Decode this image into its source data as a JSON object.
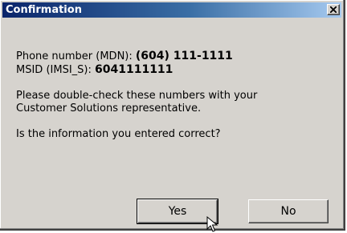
{
  "window": {
    "title": "Confirmation",
    "close_icon": "close-x-icon"
  },
  "message": {
    "phone_label": "Phone number (MDN): ",
    "phone_value": "(604) 111-1111",
    "msid_label": "MSID (IMSI_S): ",
    "msid_value": "6041111111",
    "advice_line1": "Please double-check these numbers with your",
    "advice_line2": "Customer Solutions representative.",
    "question": "Is the information you entered correct?"
  },
  "buttons": {
    "yes_label": "Yes",
    "no_label": "No"
  },
  "colors": {
    "title_bar_start": "#0a246a",
    "title_bar_end": "#a6caf0",
    "dialog_face": "#d6d3ce"
  },
  "pointer_icon": "arrow-cursor-icon"
}
